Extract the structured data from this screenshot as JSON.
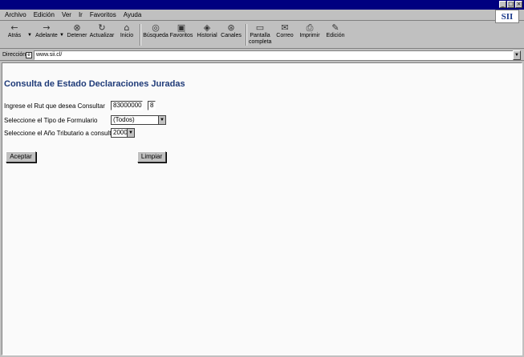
{
  "window": {
    "minimize": "_",
    "maximize": "□",
    "close": "×"
  },
  "logo": "SII",
  "menu": [
    "Archivo",
    "Edición",
    "Ver",
    "Ir",
    "Favoritos",
    "Ayuda"
  ],
  "toolbar": [
    {
      "label": "Atrás",
      "icon": "←"
    },
    {
      "label": "Adelante",
      "icon": "→"
    },
    {
      "label": "Detener",
      "icon": "⊗"
    },
    {
      "label": "Actualizar",
      "icon": "↻"
    },
    {
      "label": "Inicio",
      "icon": "⌂"
    },
    {
      "label": "Búsqueda",
      "icon": "◎"
    },
    {
      "label": "Favoritos",
      "icon": "▣"
    },
    {
      "label": "Historial",
      "icon": "◈"
    },
    {
      "label": "Canales",
      "icon": "⊛"
    },
    {
      "label": "Pantalla completa",
      "icon": "▭"
    },
    {
      "label": "Correo",
      "icon": "✉"
    },
    {
      "label": "Imprimir",
      "icon": "⎙"
    },
    {
      "label": "Edición",
      "icon": "✎"
    }
  ],
  "address": {
    "label": "Dirección",
    "value": "www.sii.cl/"
  },
  "page": {
    "title": "Consulta de Estado Declaraciones Juradas",
    "rut_label": "Ingrese el Rut que desea Consultar",
    "rut_value": "83000000",
    "rut_dv": "8",
    "tipo_label": "Seleccione el Tipo de Formulario",
    "tipo_value": "(Todos)",
    "anio_label": "Seleccione el Año Tributario a consultar",
    "anio_value": "2000",
    "aceptar": "Aceptar",
    "limpiar": "Limpiar"
  }
}
